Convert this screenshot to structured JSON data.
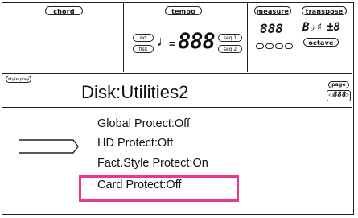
{
  "header": {
    "chord_label": "chord",
    "tempo_label": "tempo",
    "measure_label": "measure",
    "transpose_label": "transpose",
    "sxt_label": "sxt",
    "flsk_label": "flsk",
    "seq1_label": "seq 1",
    "seq2_label": "seq 2",
    "octave_label": "octave",
    "tempo_value": "888",
    "measure_value": "888",
    "transpose_value": "±8",
    "transpose_accidental": "B♭♯"
  },
  "page": {
    "mode_tag": "style play",
    "title": "Disk:Utilities2",
    "page_label": "page",
    "page_value": "888"
  },
  "menu": {
    "items": [
      {
        "label": "Global Protect:Off"
      },
      {
        "label": "HD Protect:Off"
      },
      {
        "label": "Fact.Style Protect:On"
      },
      {
        "label": "Card Protect:Off"
      }
    ]
  },
  "colors": {
    "highlight": "#e8388e",
    "ink": "#222222"
  }
}
